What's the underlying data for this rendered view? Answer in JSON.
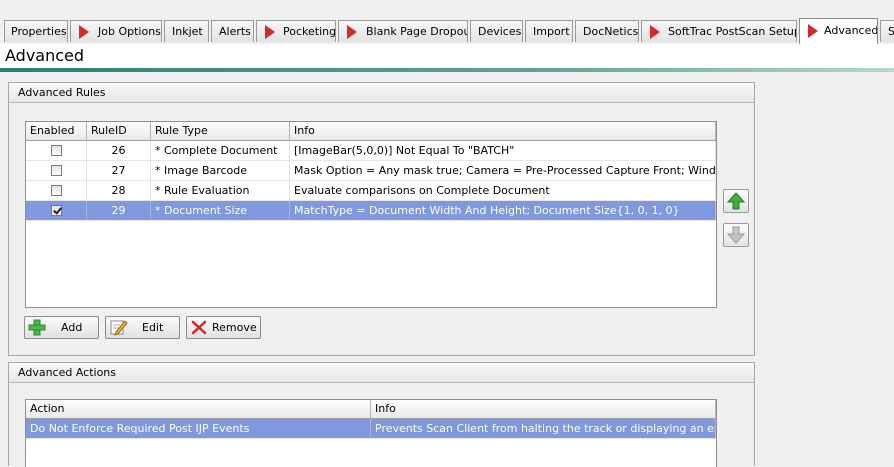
{
  "tabs": [
    {
      "label": "Properties",
      "arrow": false
    },
    {
      "label": "Job Options",
      "arrow": true
    },
    {
      "label": "Inkjet",
      "arrow": false
    },
    {
      "label": "Alerts",
      "arrow": false
    },
    {
      "label": "Pocketing",
      "arrow": true
    },
    {
      "label": "Blank Page Dropout",
      "arrow": true
    },
    {
      "label": "Devices",
      "arrow": false
    },
    {
      "label": "Import",
      "arrow": false
    },
    {
      "label": "DocNetics",
      "arrow": false
    },
    {
      "label": "SoftTrac PostScan Setup",
      "arrow": true
    },
    {
      "label": "Advanced",
      "arrow": true,
      "active": true
    },
    {
      "label": "S",
      "arrow": false
    }
  ],
  "page_title": "Advanced",
  "rules_group": {
    "title": "Advanced Rules",
    "columns": [
      "Enabled",
      "RuleID",
      "Rule Type",
      "Info"
    ],
    "rows": [
      {
        "enabled": false,
        "rule_id": "26",
        "rule_type": "* Complete Document",
        "info": "[ImageBar(5,0,0)] Not Equal To \"BATCH\""
      },
      {
        "enabled": false,
        "rule_id": "27",
        "rule_type": "* Image Barcode",
        "info": "Mask Option = Any mask true; Camera = Pre-Processed Capture Front;  Window = ..."
      },
      {
        "enabled": false,
        "rule_id": "28",
        "rule_type": "* Rule Evaluation",
        "info": "Evaluate comparisons on Complete Document"
      },
      {
        "enabled": true,
        "rule_id": "29",
        "rule_type": "* Document Size",
        "info": "MatchType = Document Width And Height; Document Size{1, 0, 1, 0}",
        "selected": true
      }
    ],
    "buttons": {
      "add": "Add",
      "edit": "Edit",
      "remove": "Remove"
    }
  },
  "actions_group": {
    "title": "Advanced Actions",
    "columns": [
      "Action",
      "Info"
    ],
    "rows": [
      {
        "action": "Do Not Enforce Required Post IJP Events",
        "info": "Prevents Scan Client from halting the track or displaying an error m...",
        "selected": true
      }
    ]
  },
  "colors": {
    "accent": "#2c7f6f",
    "selection": "#7f98de",
    "tab_arrow": "#d42a2a",
    "move_up": "#3fae3f"
  }
}
